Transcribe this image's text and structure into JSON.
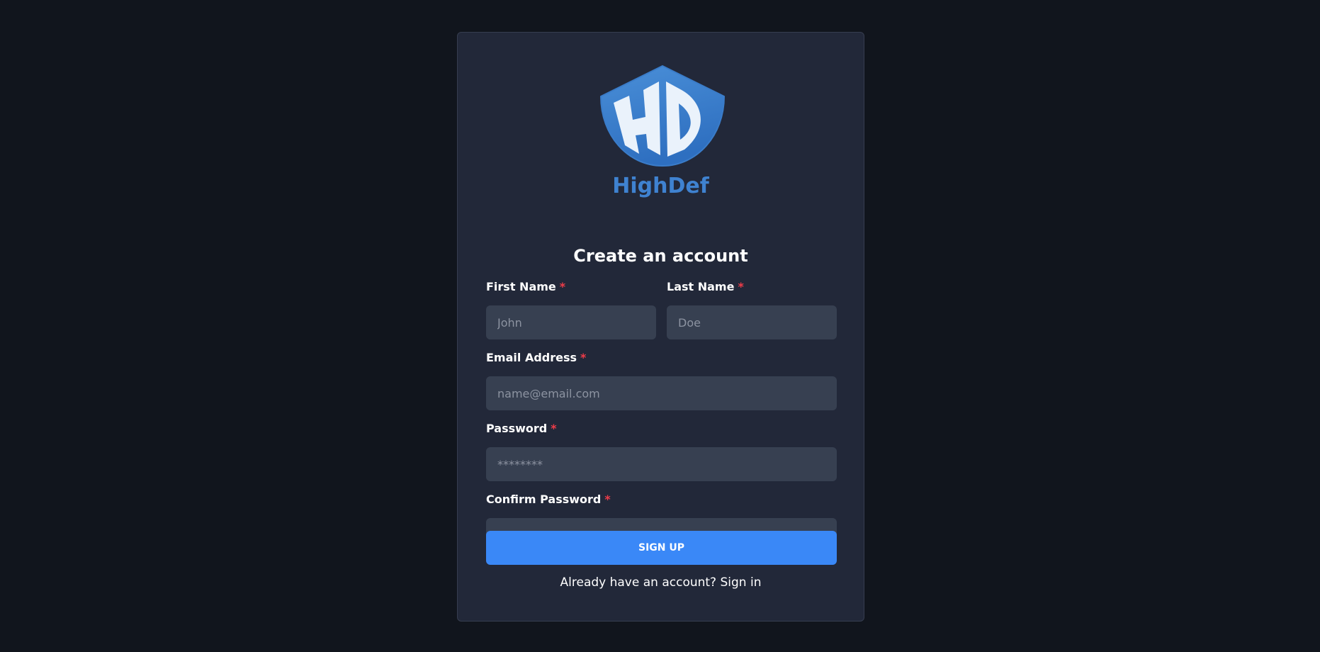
{
  "brand": {
    "name": "HighDef",
    "logo_icon": "hd-shield-logo",
    "logo_text": "HD",
    "color": "#3f82d0"
  },
  "form": {
    "title": "Create an account",
    "first_name": {
      "label": "First Name",
      "placeholder": "John",
      "required_mark": "*"
    },
    "last_name": {
      "label": "Last Name",
      "placeholder": "Doe",
      "required_mark": "*"
    },
    "email": {
      "label": "Email Address",
      "placeholder": "name@email.com",
      "required_mark": "*"
    },
    "password": {
      "label": "Password",
      "placeholder": "********",
      "required_mark": "*"
    },
    "confirm_password": {
      "label": "Confirm Password",
      "placeholder": "********",
      "required_mark": "*"
    },
    "submit_label": "SIGN UP",
    "signin_prompt": "Already have an account?",
    "signin_link": "Sign in"
  },
  "colors": {
    "background": "#11151d",
    "card": "#222839",
    "input": "#374051",
    "accent": "#3a88f7",
    "required": "#ef3c49"
  }
}
